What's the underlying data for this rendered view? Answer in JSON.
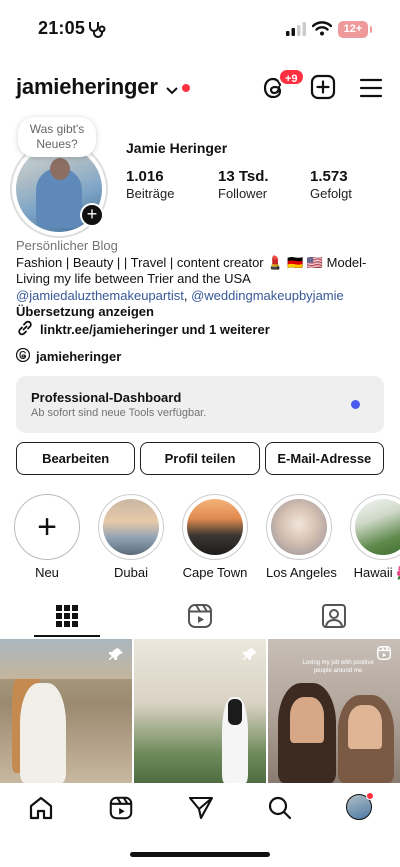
{
  "status_bar": {
    "time": "21:05",
    "battery": "12+"
  },
  "header": {
    "username": "jamieheringer",
    "threads_badge": "+9"
  },
  "profile": {
    "note": "Was gibt's Neues?",
    "full_name": "Jamie Heringer",
    "stats": [
      {
        "value": "1.016",
        "label": "Beiträge"
      },
      {
        "value": "13 Tsd.",
        "label": "Follower"
      },
      {
        "value": "1.573",
        "label": "Gefolgt"
      }
    ],
    "category": "Persönlicher Blog",
    "bio_line1": "Fashion | Beauty | | Travel |  content creator 💄 🇩🇪 🇺🇸 Model-",
    "bio_line2": "Living my life  between Trier and the USA",
    "mention1": "@jamiedaluzthemakeupartist",
    "mention_sep": ", ",
    "mention2": "@weddingmakeupbyjamie",
    "translate": "Übersetzung anzeigen",
    "link": "linktr.ee/jamieheringer und 1 weiterer",
    "threads_handle": "jamieheringer"
  },
  "dashboard": {
    "title": "Professional-Dashboard",
    "subtitle": "Ab sofort sind neue Tools verfügbar."
  },
  "buttons": {
    "edit": "Bearbeiten",
    "share": "Profil teilen",
    "email": "E-Mail-Adresse"
  },
  "highlights": [
    {
      "label": "Neu"
    },
    {
      "label": "Dubai"
    },
    {
      "label": "Cape Town"
    },
    {
      "label": "Los Angeles"
    },
    {
      "label": "Hawaii 🌺"
    }
  ],
  "grid": {
    "tile3_caption": "Loving my job with positive people around me"
  },
  "colors": {
    "accent_red": "#ff3040",
    "link_blue": "#385898",
    "dot_blue": "#4a5cf0"
  },
  "icons": [
    "health-icon",
    "signal-icon",
    "wifi-icon",
    "threads-icon",
    "add-icon",
    "menu-icon",
    "link-icon",
    "grid-icon",
    "reels-icon",
    "tagged-icon",
    "pin-icon",
    "home-icon",
    "send-icon",
    "search-icon"
  ]
}
